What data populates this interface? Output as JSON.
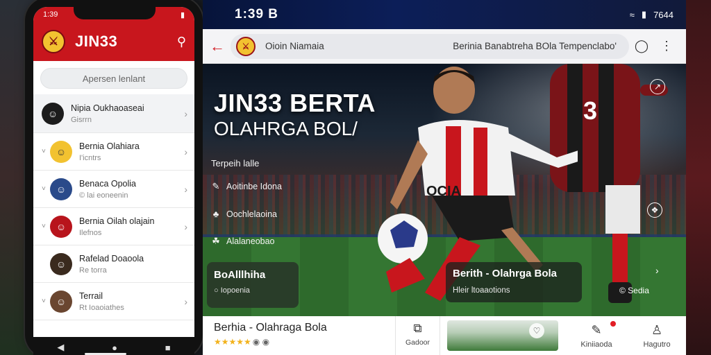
{
  "phone": {
    "status_time": "1:39",
    "app_title": "JIN33",
    "search_placeholder": "Apersen lenlant",
    "chats": [
      {
        "name": "Nipia Oukhaoaseai",
        "sub": "Gisrrn",
        "color": "#1c1c1c",
        "active": true
      },
      {
        "name": "Bernia Olahiara",
        "sub": "I'icntrs",
        "color": "#f2c230",
        "active": false
      },
      {
        "name": "Benaca Opolia",
        "sub": "© lai eoneenin",
        "color": "#2a4a8a",
        "active": false
      },
      {
        "name": "Bernia Oilah olajain",
        "sub": "Ilefnos",
        "color": "#b8141c",
        "active": false
      },
      {
        "name": "Rafelad Doaoola",
        "sub": "Re torra",
        "color": "#3a2a1e",
        "active": false
      },
      {
        "name": "Terrail",
        "sub": "Rt Ioaoiathes",
        "color": "#6a4630",
        "active": false
      }
    ]
  },
  "tablet": {
    "status_time": "1:39 B",
    "status_right": "7644",
    "address_site": "Oioin Niamaia",
    "address_page": "Berinia Banabtreha  BOla Tempenclabo'",
    "headline_1": "JIN33 BERTA",
    "headline_2": "OLAHRGA BOL/",
    "hero_list_title": "Terpeih lalle",
    "hero_items": [
      {
        "icon": "✎",
        "label": "Aoitinbe Idona"
      },
      {
        "icon": "♣",
        "label": "Oochlelaoina"
      },
      {
        "icon": "☘",
        "label": "Alalaneobao"
      }
    ],
    "card_left_title": "BoAlllhiha",
    "card_left_sub": "○ Iopoenia",
    "card_right_title": "Berith - Olahrga Bola",
    "card_right_sub": "Hleir ltoaaotions",
    "card_right_meta": "© Sedia",
    "bottom_title": "Berhia - Olahraga Bola",
    "share_label": "Gadoor",
    "nav_fav": "Kiniiaoda",
    "nav_profile": "Hagutro",
    "accent": "#c8161d"
  }
}
